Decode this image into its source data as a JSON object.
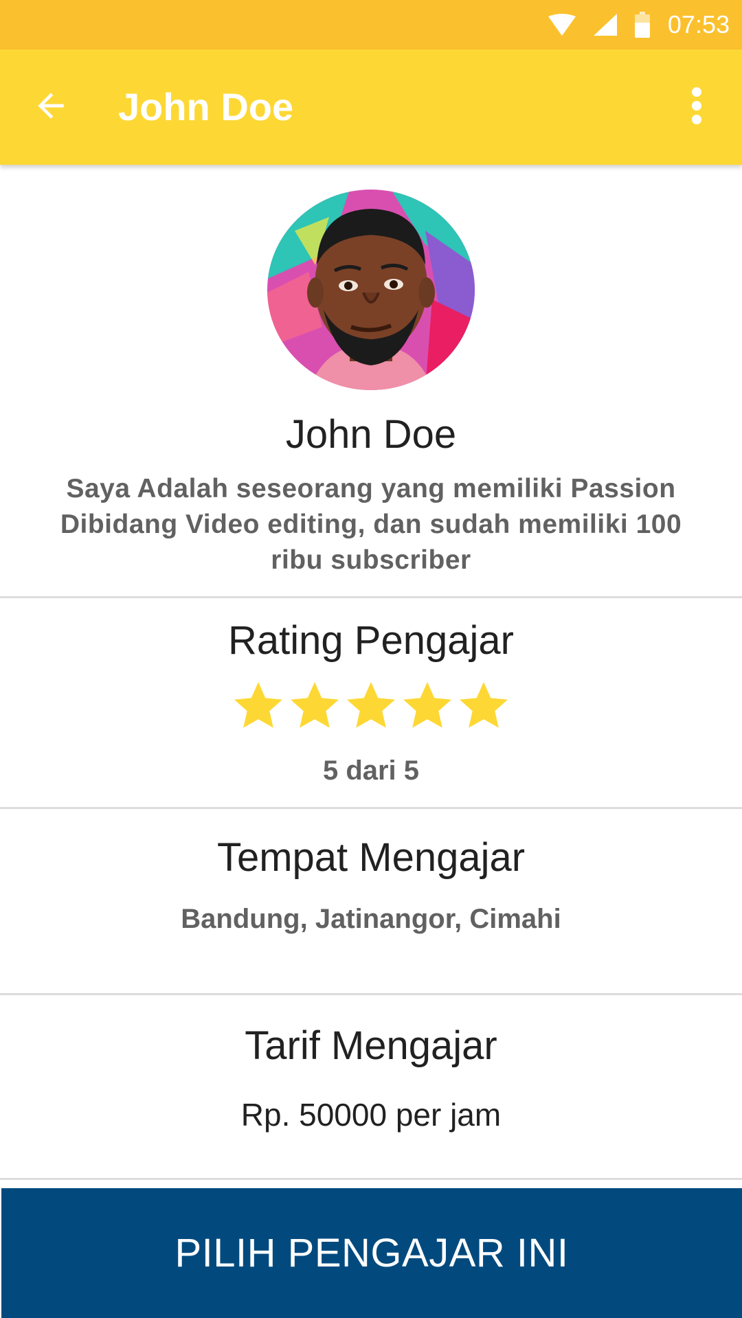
{
  "status_bar": {
    "time": "07:53",
    "icons": [
      "wifi-icon",
      "cell-signal-icon",
      "battery-icon"
    ]
  },
  "app_bar": {
    "title": "John Doe",
    "back_icon": "arrow-back-icon",
    "menu_icon": "more-vert-icon"
  },
  "profile": {
    "name": "John Doe",
    "bio": "Saya Adalah seseorang yang memiliki Passion Dibidang Video editing, dan sudah memiliki 100 ribu subscriber"
  },
  "rating": {
    "title": "Rating Pengajar",
    "stars_filled": 5,
    "stars_total": 5,
    "text": "5 dari 5"
  },
  "location": {
    "title": "Tempat Mengajar",
    "value": "Bandung, Jatinangor, Cimahi"
  },
  "fee": {
    "title": "Tarif Mengajar",
    "value": "Rp. 50000 per jam"
  },
  "action": {
    "label": "PILIH PENGAJAR INI"
  },
  "colors": {
    "status_bar": "#fbc02d",
    "app_bar": "#fdd835",
    "star": "#fdd835",
    "button": "#024a7e"
  }
}
